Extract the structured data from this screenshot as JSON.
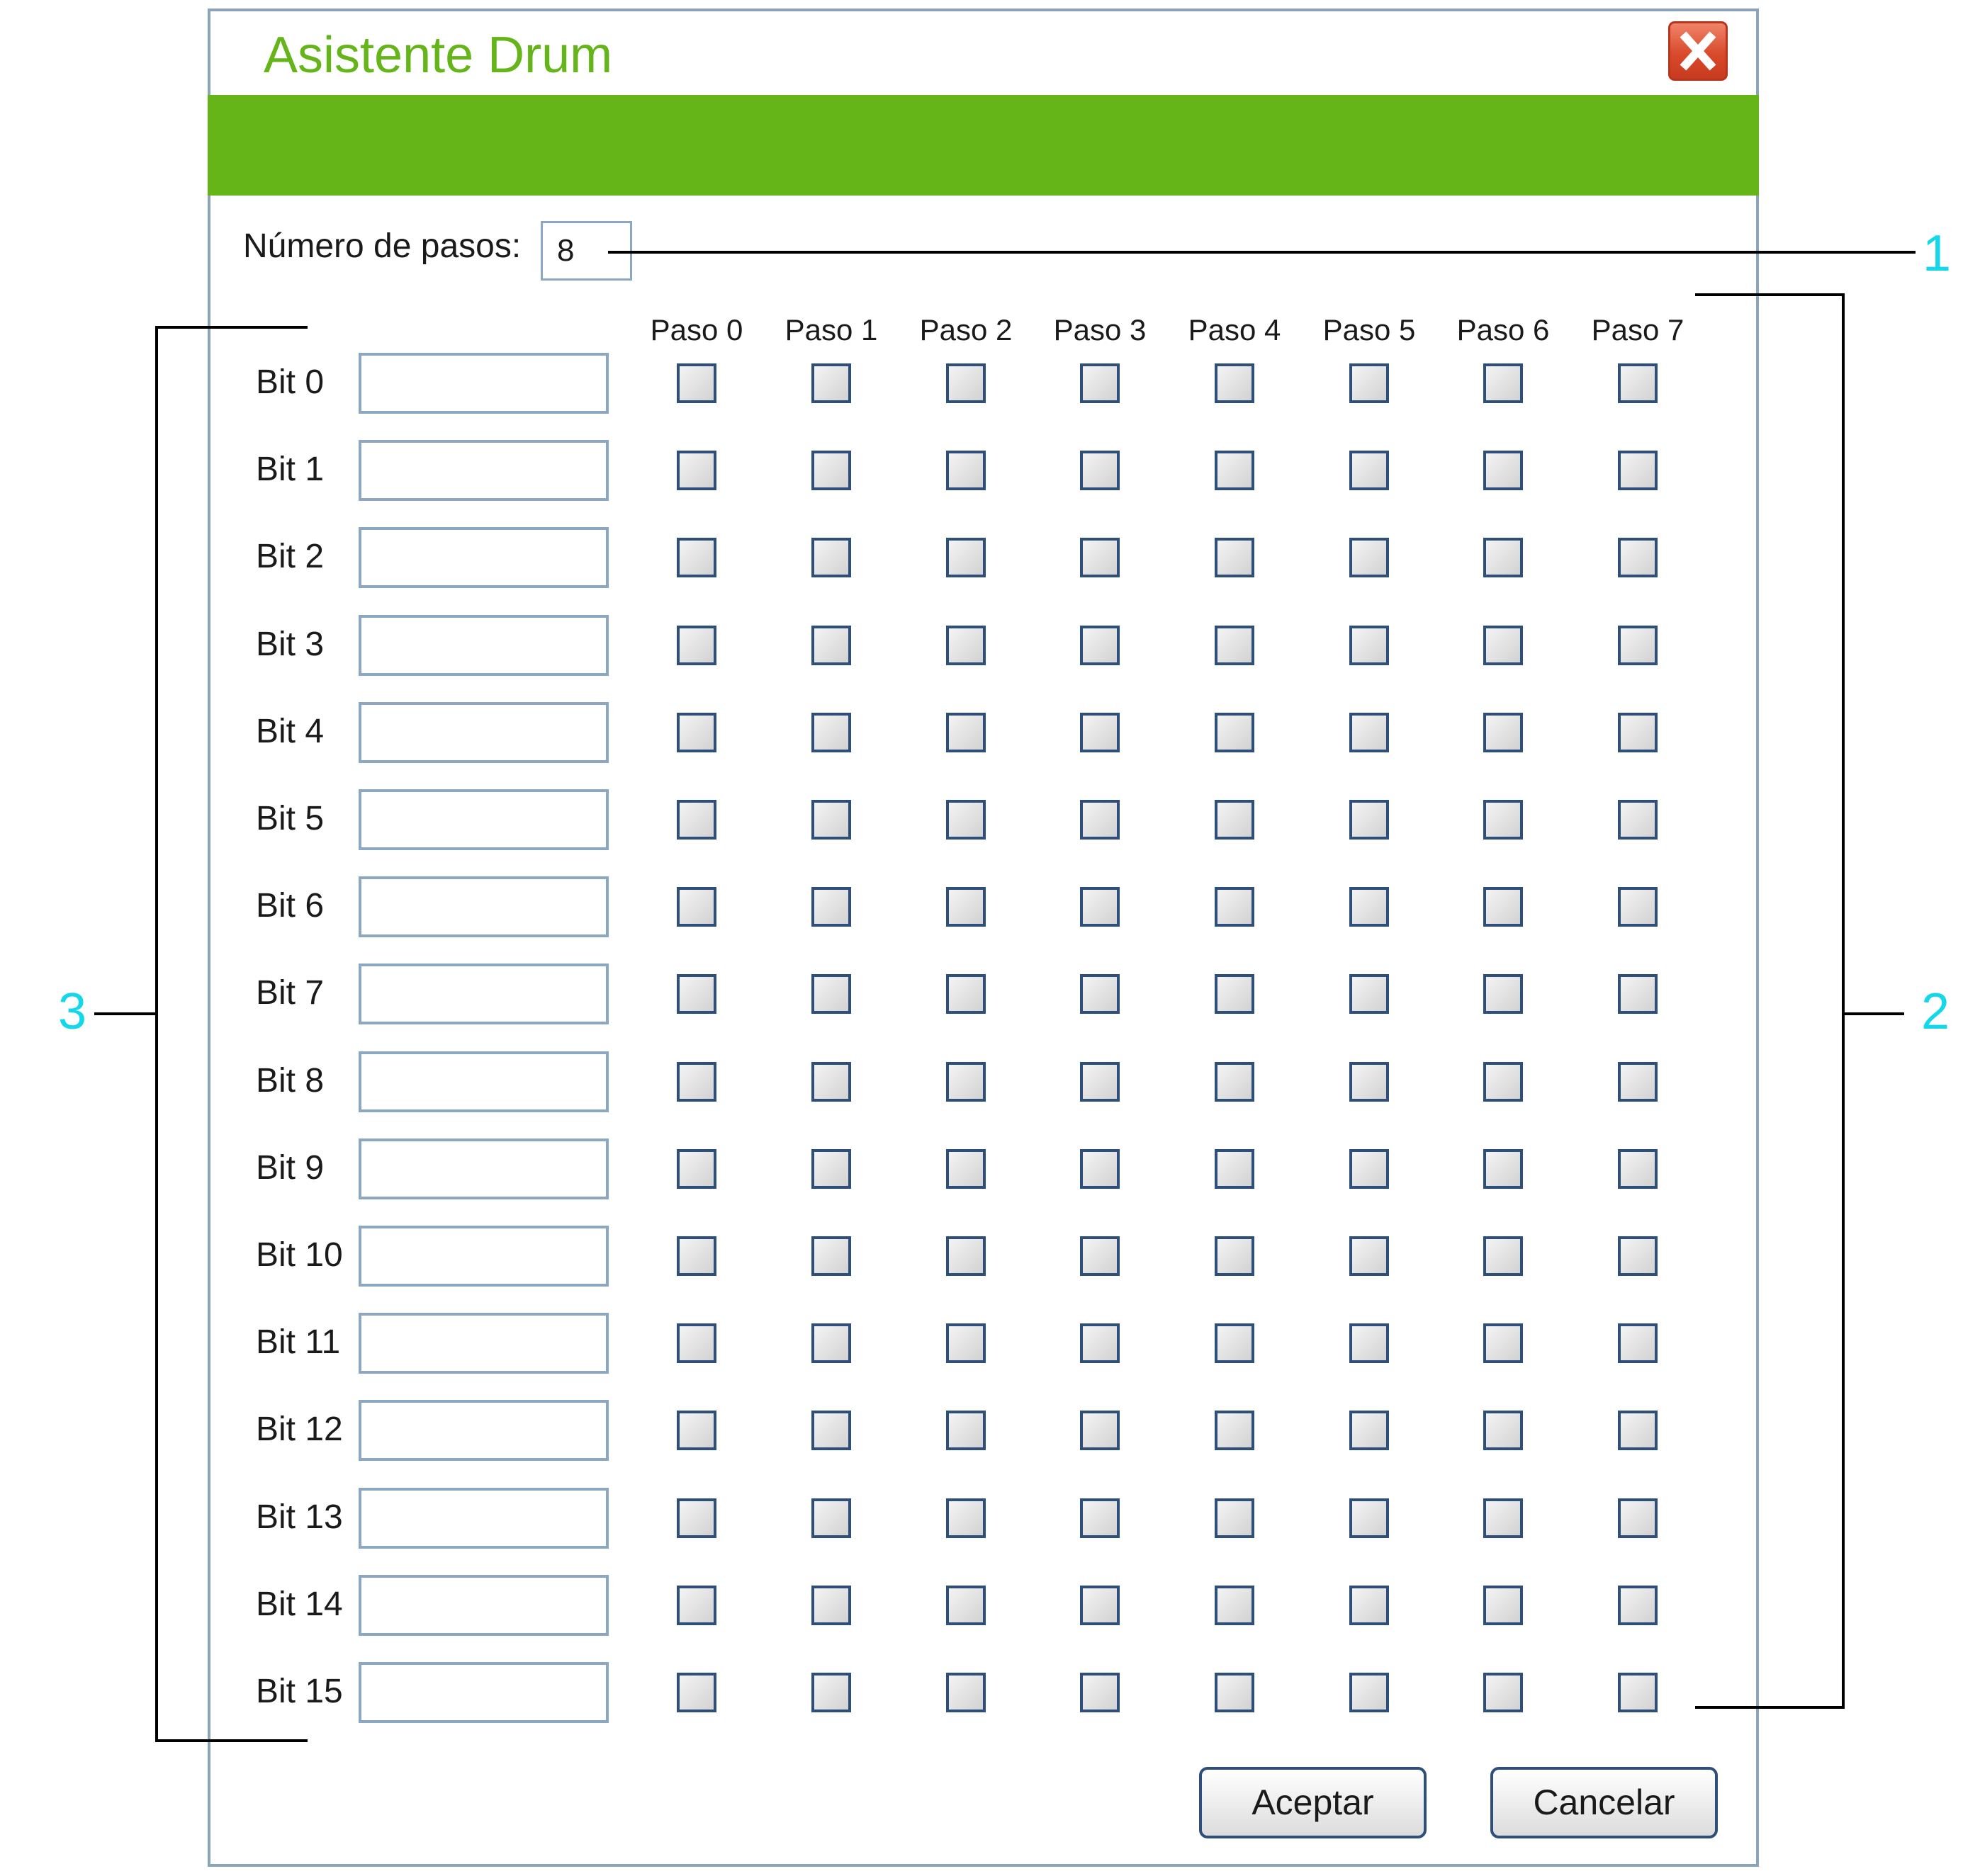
{
  "dialog": {
    "title": "Asistente Drum",
    "close_icon": "close-icon",
    "steps_label": "Número de pasos:",
    "steps_value": "8",
    "step_headers": [
      "Paso 0",
      "Paso 1",
      "Paso 2",
      "Paso 3",
      "Paso 4",
      "Paso 5",
      "Paso 6",
      "Paso 7"
    ],
    "bit_labels": [
      "Bit 0",
      "Bit 1",
      "Bit 2",
      "Bit 3",
      "Bit 4",
      "Bit 5",
      "Bit 6",
      "Bit 7",
      "Bit 8",
      "Bit 9",
      "Bit 10",
      "Bit 11",
      "Bit 12",
      "Bit 13",
      "Bit 14",
      "Bit 15"
    ],
    "bit_values": [
      "",
      "",
      "",
      "",
      "",
      "",
      "",
      "",
      "",
      "",
      "",
      "",
      "",
      "",
      "",
      ""
    ],
    "checkbox_states": "all unchecked",
    "accept_label": "Aceptar",
    "cancel_label": "Cancelar",
    "colors": {
      "accent": "#65b518",
      "title": "#64b41a",
      "callout": "#14d7eb",
      "close": "#d94a2c"
    }
  },
  "callouts": {
    "steps": "1",
    "grid": "2",
    "bits": "3"
  }
}
